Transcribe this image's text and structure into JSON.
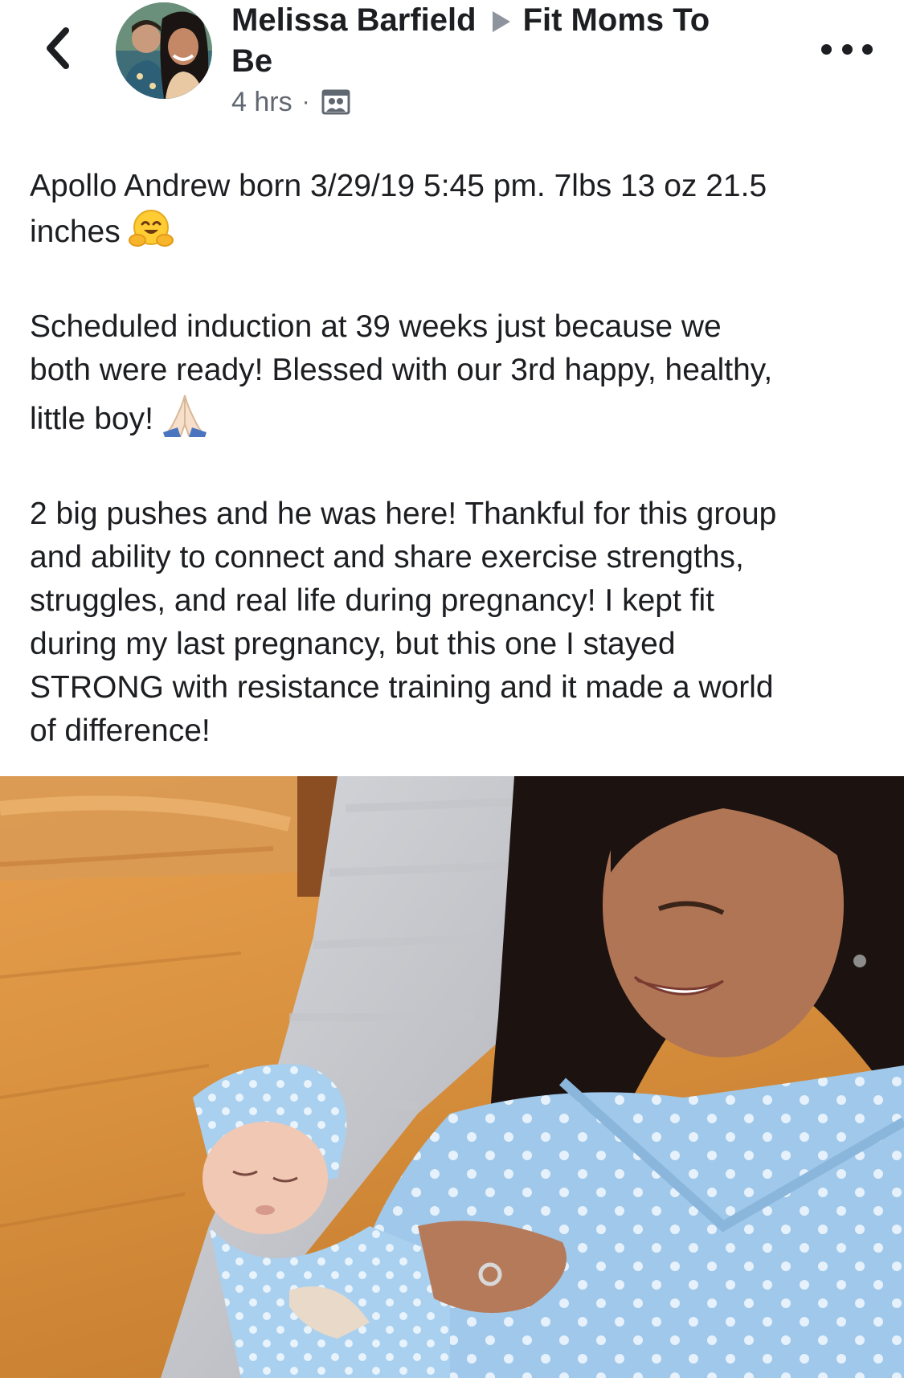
{
  "header": {
    "back_icon": "chevron-left-icon",
    "author": "Melissa Barfield",
    "group_line1": "Fit Moms To",
    "group_line2": "Be",
    "time": "4 hrs",
    "separator": "·",
    "audience_icon": "group-members-icon",
    "more_icon": "more-horizontal-icon"
  },
  "post": {
    "p1_text": "Apollo Andrew born 3/29/19 5:45 pm. 7lbs 13 oz 21.5",
    "p1_text2": "inches",
    "p1_emoji": "hugging-face-emoji",
    "p2_line1": "Scheduled induction at 39 weeks just because we",
    "p2_line2": "both were ready! Blessed with our 3rd happy, healthy,",
    "p2_line3": "little boy!",
    "p2_emoji": "folded-hands-emoji",
    "p3_line1": "2 big pushes and he was here! Thankful for this group",
    "p3_line2": "and ability to connect and share exercise strengths,",
    "p3_line3": "struggles, and real life during pregnancy! I kept fit",
    "p3_line4": "during my last pregnancy, but this one I stayed",
    "p3_line5": "STRONG with resistance training and it made a world",
    "p3_line6": "of difference!"
  },
  "photo": {
    "subject": "mother-holding-newborn-photo"
  },
  "colors": {
    "text": "#1c1e21",
    "meta": "#606770",
    "arrow": "#8d949e",
    "background": "#ffffff"
  }
}
